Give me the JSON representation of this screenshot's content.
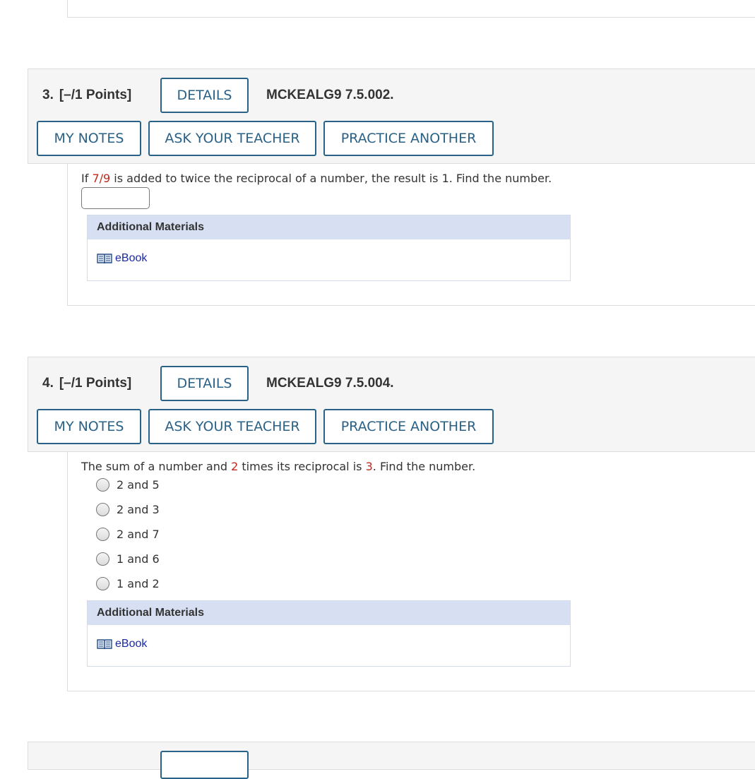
{
  "q3": {
    "number": "3.",
    "points": "[–/1 Points]",
    "details_label": "DETAILS",
    "code": "MCKEALG9 7.5.002.",
    "my_notes_label": "MY NOTES",
    "ask_teacher_label": "ASK YOUR TEACHER",
    "practice_label": "PRACTICE ANOTHER",
    "prompt_pre": "If ",
    "prompt_value": "7/9",
    "prompt_post": " is added to twice the reciprocal of a number, the result is 1. Find the number.",
    "answer_value": "",
    "materials_header": "Additional Materials",
    "ebook_label": "eBook"
  },
  "q4": {
    "number": "4.",
    "points": "[–/1 Points]",
    "details_label": "DETAILS",
    "code": "MCKEALG9 7.5.004.",
    "my_notes_label": "MY NOTES",
    "ask_teacher_label": "ASK YOUR TEACHER",
    "practice_label": "PRACTICE ANOTHER",
    "prompt_pre": "The sum of a number and ",
    "prompt_value1": "2",
    "prompt_mid": " times its reciprocal is ",
    "prompt_value2": "3",
    "prompt_post": ". Find the number.",
    "choices": [
      "2 and 5",
      "2 and 3",
      "2 and 7",
      "1 and 6",
      "1 and 2"
    ],
    "materials_header": "Additional Materials",
    "ebook_label": "eBook"
  },
  "colors": {
    "accent": "#2a6187",
    "highlight_value": "#c0281e",
    "materials_header_bg": "#d7dff2",
    "link": "#1a2aa0"
  },
  "icons": {
    "ebook": "book-icon"
  }
}
